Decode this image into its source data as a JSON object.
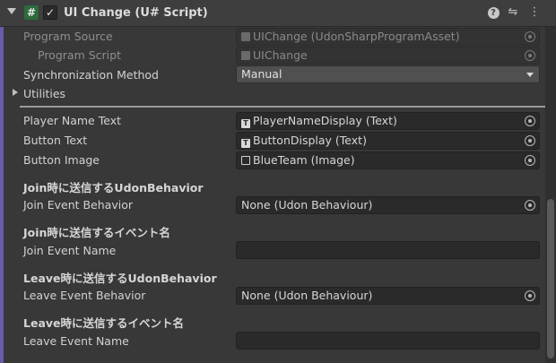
{
  "header": {
    "title": "UI Change (U# Script)",
    "hash_glyph": "#",
    "check_glyph": "✓",
    "help_icon": "?",
    "settings_icon": "⇋",
    "menu_icon": "⋮"
  },
  "program_source": {
    "label": "Program Source",
    "value": "UIChange (UdonSharpProgramAsset)"
  },
  "program_script": {
    "label": "Program Script",
    "value": "UIChange"
  },
  "sync": {
    "label": "Synchronization Method",
    "value": "Manual"
  },
  "utilities": {
    "label": "Utilities"
  },
  "player_name_text": {
    "label": "Player Name Text",
    "value": "PlayerNameDisplay (Text)"
  },
  "button_text": {
    "label": "Button Text",
    "value": "ButtonDisplay (Text)"
  },
  "button_image": {
    "label": "Button Image",
    "value": "BlueTeam (Image)"
  },
  "join_behavior_section": "Join時に送信するUdonBehavior",
  "join_event_behavior": {
    "label": "Join Event Behavior",
    "value": "None (Udon Behaviour)"
  },
  "join_name_section": "Join時に送信するイベント名",
  "join_event_name": {
    "label": "Join Event Name",
    "value": ""
  },
  "leave_behavior_section": "Leave時に送信するUdonBehavior",
  "leave_event_behavior": {
    "label": "Leave Event Behavior",
    "value": "None (Udon Behaviour)"
  },
  "leave_name_section": "Leave時に送信するイベント名",
  "leave_event_name": {
    "label": "Leave Event Name",
    "value": ""
  },
  "colors": {
    "accent_bar": "#6b5aa8",
    "script_icon": "#2d6b3c"
  }
}
